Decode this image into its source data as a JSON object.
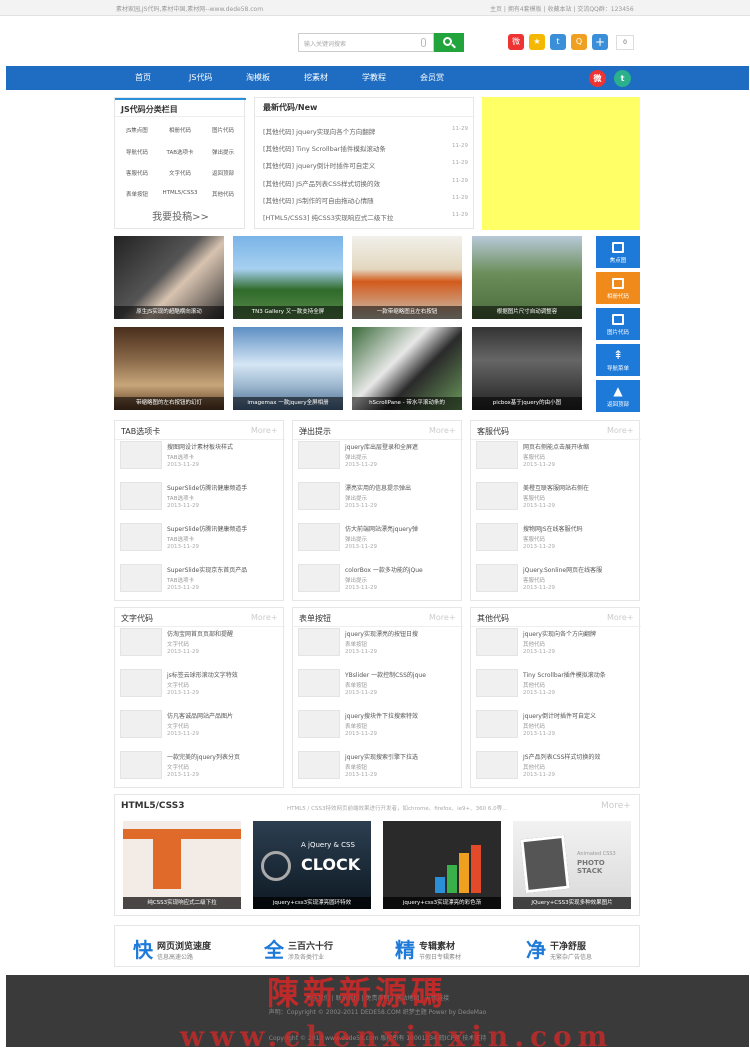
{
  "topbar": {
    "left": "素材家园,JS代码,素材中国,素材网--www.dede58.com",
    "right": "主页 | 拥有4套模板 | 收藏本站 | 交流QQ群：123456"
  },
  "search": {
    "placeholder": "输入关键词搜索"
  },
  "share": {
    "count": "0"
  },
  "nav": [
    "首页",
    "JS代码",
    "淘模板",
    "挖素材",
    "学教程",
    "会员赏"
  ],
  "categories": {
    "title": "JS代码分类栏目",
    "items": [
      "JS焦点图",
      "相册代码",
      "图片代码",
      "导航代码",
      "TAB选项卡",
      "弹出提示",
      "客服代码",
      "文字代码",
      "返回顶部",
      "表单按钮",
      "HTML5/CSS3",
      "其他代码"
    ],
    "more": "我要投稿>>"
  },
  "latest": {
    "title": "最新代码/New",
    "rows": [
      {
        "t": "[其他代码] jquery实现向各个方向翻牌",
        "d": "11-29"
      },
      {
        "t": "[其他代码] Tiny Scrollbar插件模拟滚动条",
        "d": "11-29"
      },
      {
        "t": "[其他代码] jquery倒计时插件可自定义",
        "d": "11-29"
      },
      {
        "t": "[其他代码] JS产品列表CSS样式切换的效",
        "d": "11-29"
      },
      {
        "t": "[其他代码] JS制作的可自由拖动心情随",
        "d": "11-29"
      },
      {
        "t": "[HTML5/CSS3] 纯CSS3实现响应式二级下拉",
        "d": "11-29"
      }
    ]
  },
  "gallery": [
    "原生JS实现的超酷横向滚动",
    "TN3 Gallery 又一款支持全屏",
    "一款带缩略图且左右按钮",
    "根据图片尺寸自动调整容",
    "带缩略图的左右按钮的幻灯",
    "imagemax 一款jquery全屏相册",
    "hScrollPane - 带水平滚动条的",
    "picbox基于jquery的由小图"
  ],
  "side": [
    "焦点图",
    "相册代码",
    "图片代码",
    "导航菜单",
    "返回顶部"
  ],
  "sections": [
    {
      "title": "TAB选项卡",
      "more": "More+",
      "items": [
        {
          "t": "搜图网设计素材板块样式",
          "c": "TAB选项卡",
          "d": "2013-11-29"
        },
        {
          "t": "SuperSlide仿腾讯健康频道手",
          "c": "TAB选项卡",
          "d": "2013-11-29"
        },
        {
          "t": "SuperSlide仿腾讯健康频道手",
          "c": "TAB选项卡",
          "d": "2013-11-29"
        },
        {
          "t": "SuperSlide实现京东首页产品",
          "c": "TAB选项卡",
          "d": "2013-11-29"
        }
      ]
    },
    {
      "title": "弹出提示",
      "more": "More+",
      "items": [
        {
          "t": "jquery库出层登录和全屏遮",
          "c": "弹出提示",
          "d": "2013-11-29"
        },
        {
          "t": "漂亮实用的信息提示弹出",
          "c": "弹出提示",
          "d": "2013-11-29"
        },
        {
          "t": "仿大前端网站漂亮jquery弹",
          "c": "弹出提示",
          "d": "2013-11-29"
        },
        {
          "t": "colorBox 一款多功能的jQue",
          "c": "弹出提示",
          "d": "2013-11-29"
        }
      ]
    },
    {
      "title": "客服代码",
      "more": "More+",
      "items": [
        {
          "t": "网页右侧能点击展开收缩",
          "c": "客服代码",
          "d": "2013-11-29"
        },
        {
          "t": "美橙互联客服网站右侧在",
          "c": "客服代码",
          "d": "2013-11-29"
        },
        {
          "t": "搜物网JS在线客服代码",
          "c": "客服代码",
          "d": "2013-11-29"
        },
        {
          "t": "jQuery.Sonline网页在线客服",
          "c": "客服代码",
          "d": "2013-11-29"
        }
      ]
    },
    {
      "title": "文字代码",
      "more": "More+",
      "items": [
        {
          "t": "仿淘宝网首页页部和提醒",
          "c": "文字代码",
          "d": "2013-11-29"
        },
        {
          "t": "js标签云球形滚动文字特效",
          "c": "文字代码",
          "d": "2013-11-29"
        },
        {
          "t": "仿凡客诚品网站产品图片",
          "c": "文字代码",
          "d": "2013-11-29"
        },
        {
          "t": "一款完美的jquery列表分页",
          "c": "文字代码",
          "d": "2013-11-29"
        }
      ]
    },
    {
      "title": "表单按钮",
      "more": "More+",
      "items": [
        {
          "t": "jquery实现漂亮的按钮日搜",
          "c": "表单按钮",
          "d": "2013-11-29"
        },
        {
          "t": "YBslider 一款控制CSS的jque",
          "c": "表单按钮",
          "d": "2013-11-29"
        },
        {
          "t": "jquery搜块件下拉搜索特效",
          "c": "表单按钮",
          "d": "2013-11-29"
        },
        {
          "t": "jquery实现搜索引擎下拉选",
          "c": "表单按钮",
          "d": "2013-11-29"
        }
      ]
    },
    {
      "title": "其他代码",
      "more": "More+",
      "items": [
        {
          "t": "jquery实现向各个方向翻牌",
          "c": "其他代码",
          "d": "2013-11-29"
        },
        {
          "t": "Tiny Scrollbar插件模拟滚动条",
          "c": "其他代码",
          "d": "2013-11-29"
        },
        {
          "t": "jquery倒计时插件可自定义",
          "c": "其他代码",
          "d": "2013-11-29"
        },
        {
          "t": "JS产品列表CSS样式切换的效",
          "c": "其他代码",
          "d": "2013-11-29"
        }
      ]
    }
  ],
  "html5": {
    "title": "HTML5/CSS3",
    "sub": "HTML5 / CSS3特效网页前端效果进行开发者，如chrome、firefox、ie9+、360 6.0等...",
    "more": "More+",
    "items": [
      "纯CSS3实现响应式二级下拉",
      "jquery+css3实现漂亮圆环特效",
      "jquery+css3实现漂亮的彩色渐",
      "JQuery+CSS3实现多种效果图片"
    ],
    "clock": "CLOCK",
    "clock_pre": "A jQuery & CSS",
    "photo": "PHOTO STACK",
    "photo_pre": "Animated CSS3"
  },
  "features": [
    {
      "big": "快",
      "h": "网页浏览速度",
      "s": "信息高速公路"
    },
    {
      "big": "全",
      "h": "三百六十行",
      "s": "涉及各类行业"
    },
    {
      "big": "精",
      "h": "专辑素材",
      "s": "节假日专辑素材"
    },
    {
      "big": "净",
      "h": "干净舒服",
      "s": "无繁杂广告信息"
    }
  ],
  "footer": {
    "l1": "关于我们 | 联系我们 | 免责声明 | 网站地图 | 友情链接",
    "l2": "声明：Copyright © 2002-2011 DEDE58.COM 织梦主题 Power by DedeMao",
    "l3": "Copyright © 2013 www.dede58.com 版权所有 18001234 皖ICP备 技术支持"
  },
  "watermark": {
    "top": "陳新新源碼",
    "bottom": "www.chenxinxin.com"
  }
}
